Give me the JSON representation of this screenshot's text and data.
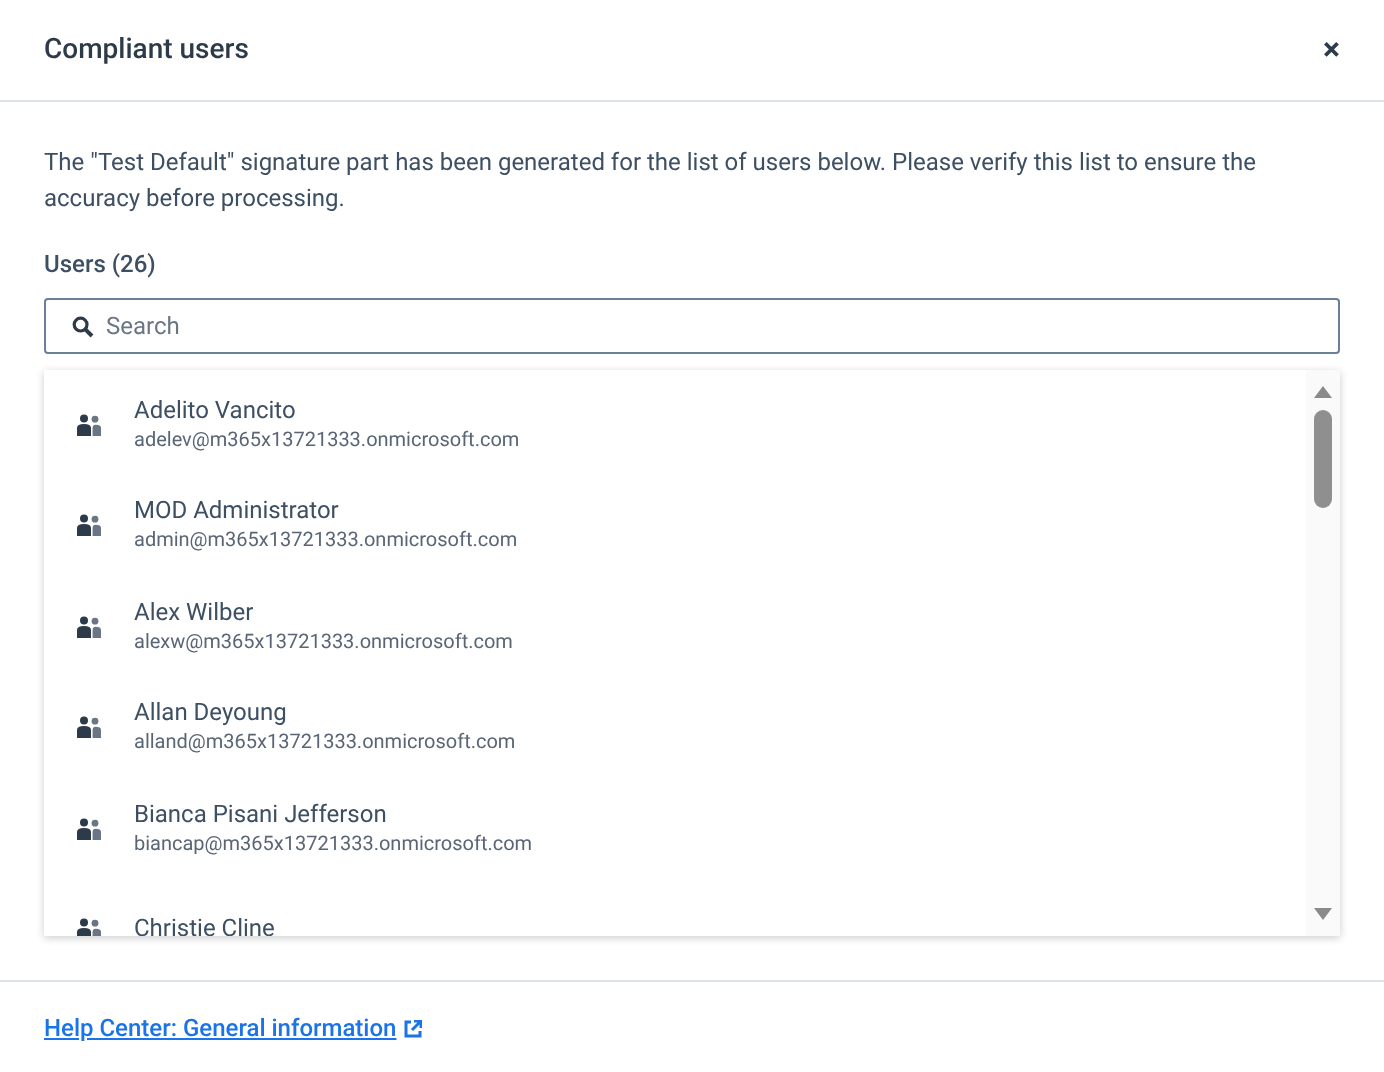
{
  "dialog": {
    "title": "Compliant users",
    "close": "×"
  },
  "description": "The \"Test Default\" signature part has been generated for the list of users below. Please verify this list to ensure the accuracy before processing.",
  "users_label": "Users (26)",
  "search": {
    "placeholder": "Search"
  },
  "users": [
    {
      "name": "Adelito Vancito",
      "email": "adelev@m365x13721333.onmicrosoft.com"
    },
    {
      "name": "MOD Administrator",
      "email": "admin@m365x13721333.onmicrosoft.com"
    },
    {
      "name": "Alex Wilber",
      "email": "alexw@m365x13721333.onmicrosoft.com"
    },
    {
      "name": "Allan Deyoung",
      "email": "alland@m365x13721333.onmicrosoft.com"
    },
    {
      "name": "Bianca Pisani Jefferson",
      "email": "biancap@m365x13721333.onmicrosoft.com"
    },
    {
      "name": "Christie Cline"
    }
  ],
  "footer": {
    "link": "Help Center: General information"
  }
}
